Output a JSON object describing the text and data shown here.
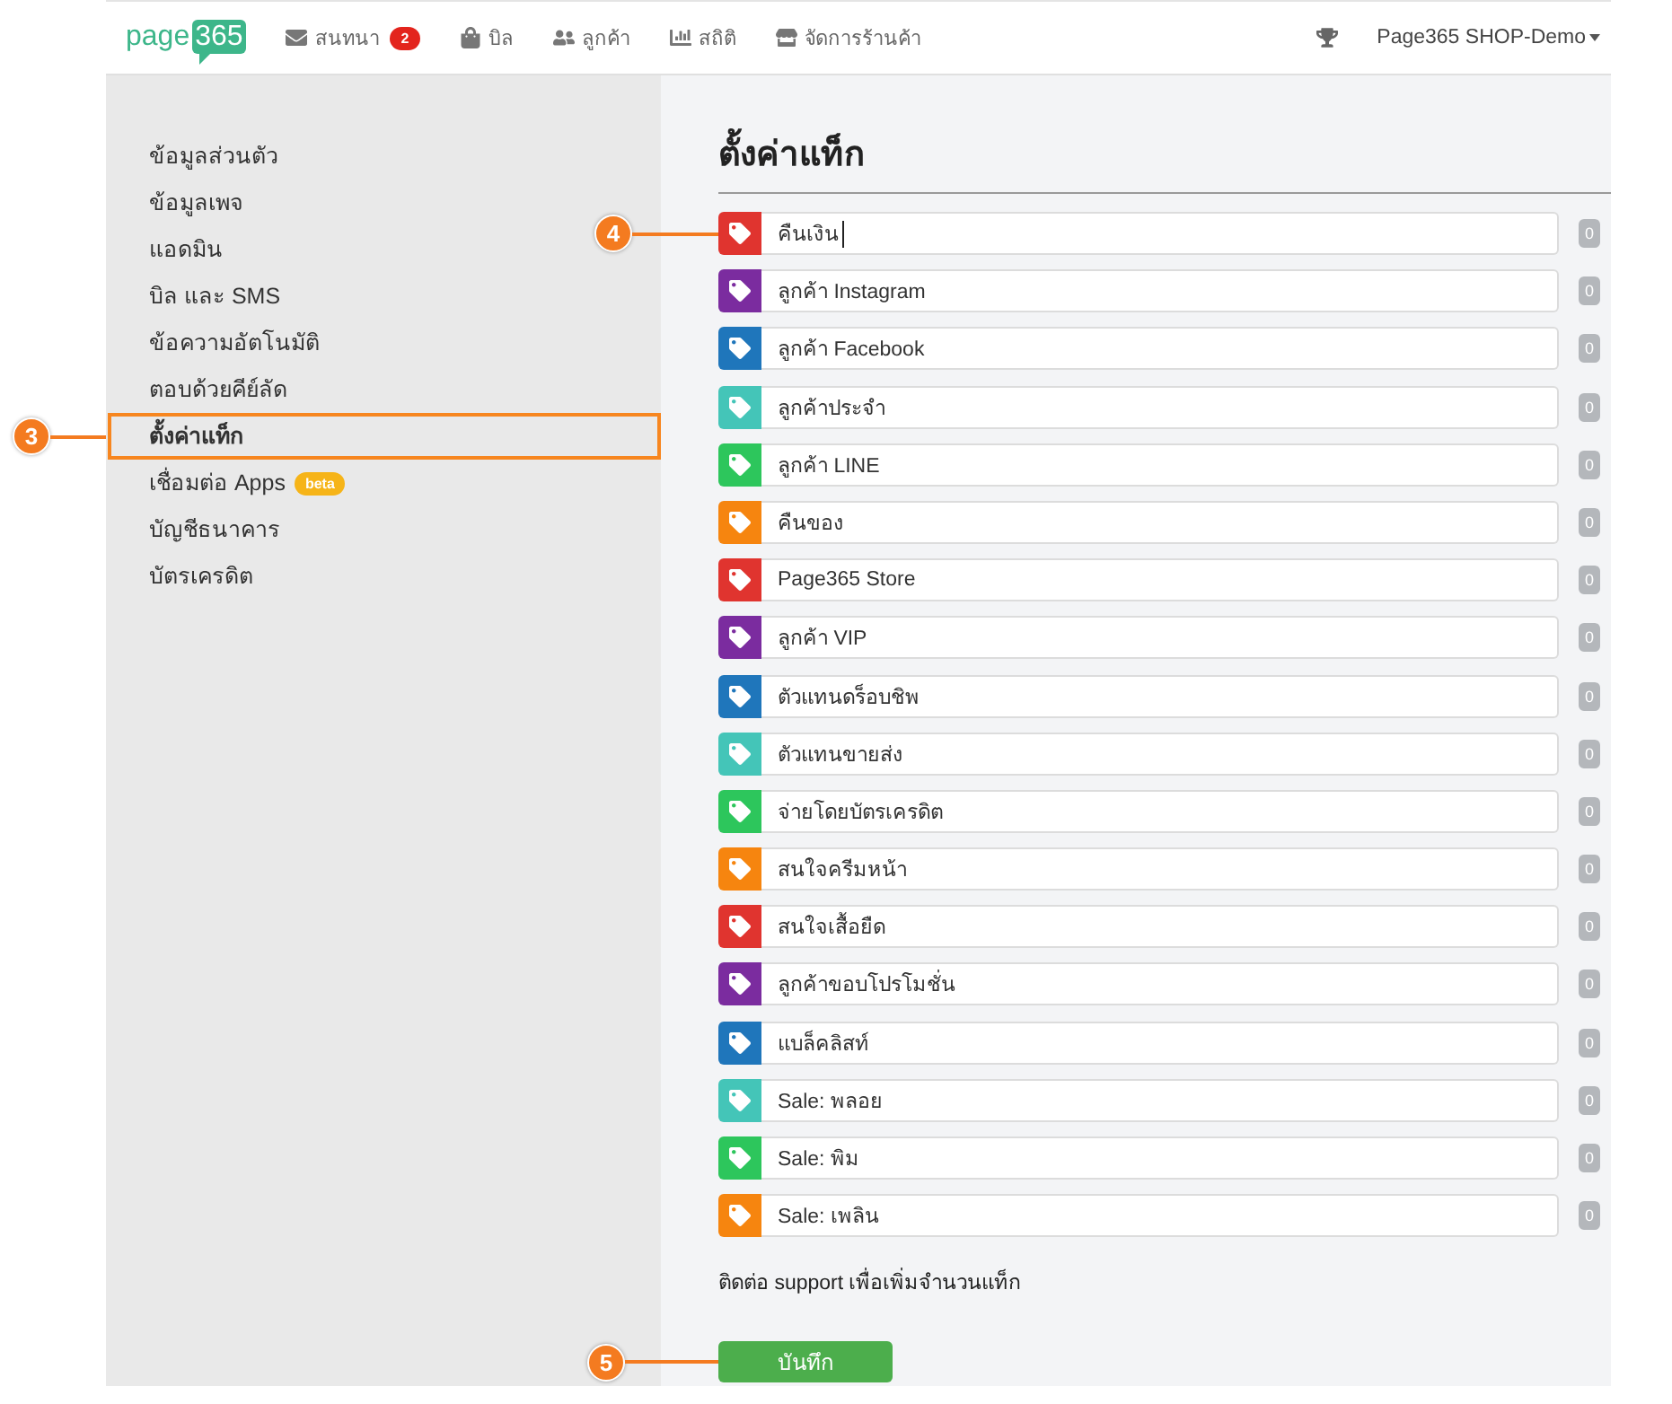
{
  "nav": {
    "logo": {
      "text": "page",
      "highlight": "365"
    },
    "items": [
      {
        "label": "สนทนา",
        "badge": "2"
      },
      {
        "label": "บิล"
      },
      {
        "label": "ลูกค้า"
      },
      {
        "label": "สถิติ"
      },
      {
        "label": "จัดการร้านค้า"
      }
    ],
    "account": {
      "label": "Page365 SHOP-Demo"
    }
  },
  "sidebar": {
    "items": [
      {
        "label": "ข้อมูลส่วนตัว",
        "selected": false
      },
      {
        "label": "ข้อมูลเพจ",
        "selected": false
      },
      {
        "label": "แอดมิน",
        "selected": false
      },
      {
        "label": "บิล และ SMS",
        "selected": false
      },
      {
        "label": "ข้อความอัตโนมัติ",
        "selected": false
      },
      {
        "label": "ตอบด้วยคีย์ลัด",
        "selected": false
      },
      {
        "label": "ตั้งค่าแท็ก",
        "selected": true,
        "callout": {
          "number": "3",
          "outlined": true
        }
      },
      {
        "label": "เชื่อมต่อ Apps",
        "selected": false,
        "badge": "beta"
      },
      {
        "label": "บัญชีธนาคาร",
        "selected": false
      },
      {
        "label": "บัตรเครดิต",
        "selected": false
      }
    ]
  },
  "page": {
    "title": "ตั้งค่าแท็ก",
    "tags": [
      {
        "name": "คืนเงิน",
        "color": "#e0342f",
        "count": "0",
        "focused": true,
        "callout": {
          "number": "4"
        }
      },
      {
        "name": "ลูกค้า Instagram",
        "color": "#7b2c9f",
        "count": "0",
        "focused": false
      },
      {
        "name": "ลูกค้า Facebook",
        "color": "#1f76bb",
        "count": "0",
        "focused": false
      },
      {
        "name": "ลูกค้าประจำ",
        "color": "#44c5b8",
        "count": "0",
        "focused": false
      },
      {
        "name": "ลูกค้า LINE",
        "color": "#2dc65c",
        "count": "0",
        "focused": false
      },
      {
        "name": "คืนของ",
        "color": "#f6850f",
        "count": "0",
        "focused": false
      },
      {
        "name": "Page365 Store",
        "color": "#e0342f",
        "count": "0",
        "focused": false
      },
      {
        "name": "ลูกค้า VIP",
        "color": "#7b2c9f",
        "count": "0",
        "focused": false
      },
      {
        "name": "ตัวแทนดร็อบชิพ",
        "color": "#1f76bb",
        "count": "0",
        "focused": false
      },
      {
        "name": "ตัวแทนขายส่ง",
        "color": "#44c5b8",
        "count": "0",
        "focused": false
      },
      {
        "name": "จ่ายโดยบัตรเครดิต",
        "color": "#2dc65c",
        "count": "0",
        "focused": false
      },
      {
        "name": "สนใจครีมหน้า",
        "color": "#f6850f",
        "count": "0",
        "focused": false
      },
      {
        "name": "สนใจเสื้อยืด",
        "color": "#e0342f",
        "count": "0",
        "focused": false
      },
      {
        "name": "ลูกค้าขอบโปรโมชั่น",
        "color": "#7b2c9f",
        "count": "0",
        "focused": false
      },
      {
        "name": "แบล็คลิสท์",
        "color": "#1f76bb",
        "count": "0",
        "focused": false
      },
      {
        "name": "Sale: พลอย",
        "color": "#44c5b8",
        "count": "0",
        "focused": false
      },
      {
        "name": "Sale: พิม",
        "color": "#2dc65c",
        "count": "0",
        "focused": false
      },
      {
        "name": "Sale: เพลิน",
        "color": "#f6850f",
        "count": "0",
        "focused": false
      }
    ],
    "note": "ติดต่อ support เพื่อเพิ่มจำนวนแท็ก",
    "save_button": {
      "label": "บันทึก",
      "callout": {
        "number": "5"
      }
    }
  }
}
